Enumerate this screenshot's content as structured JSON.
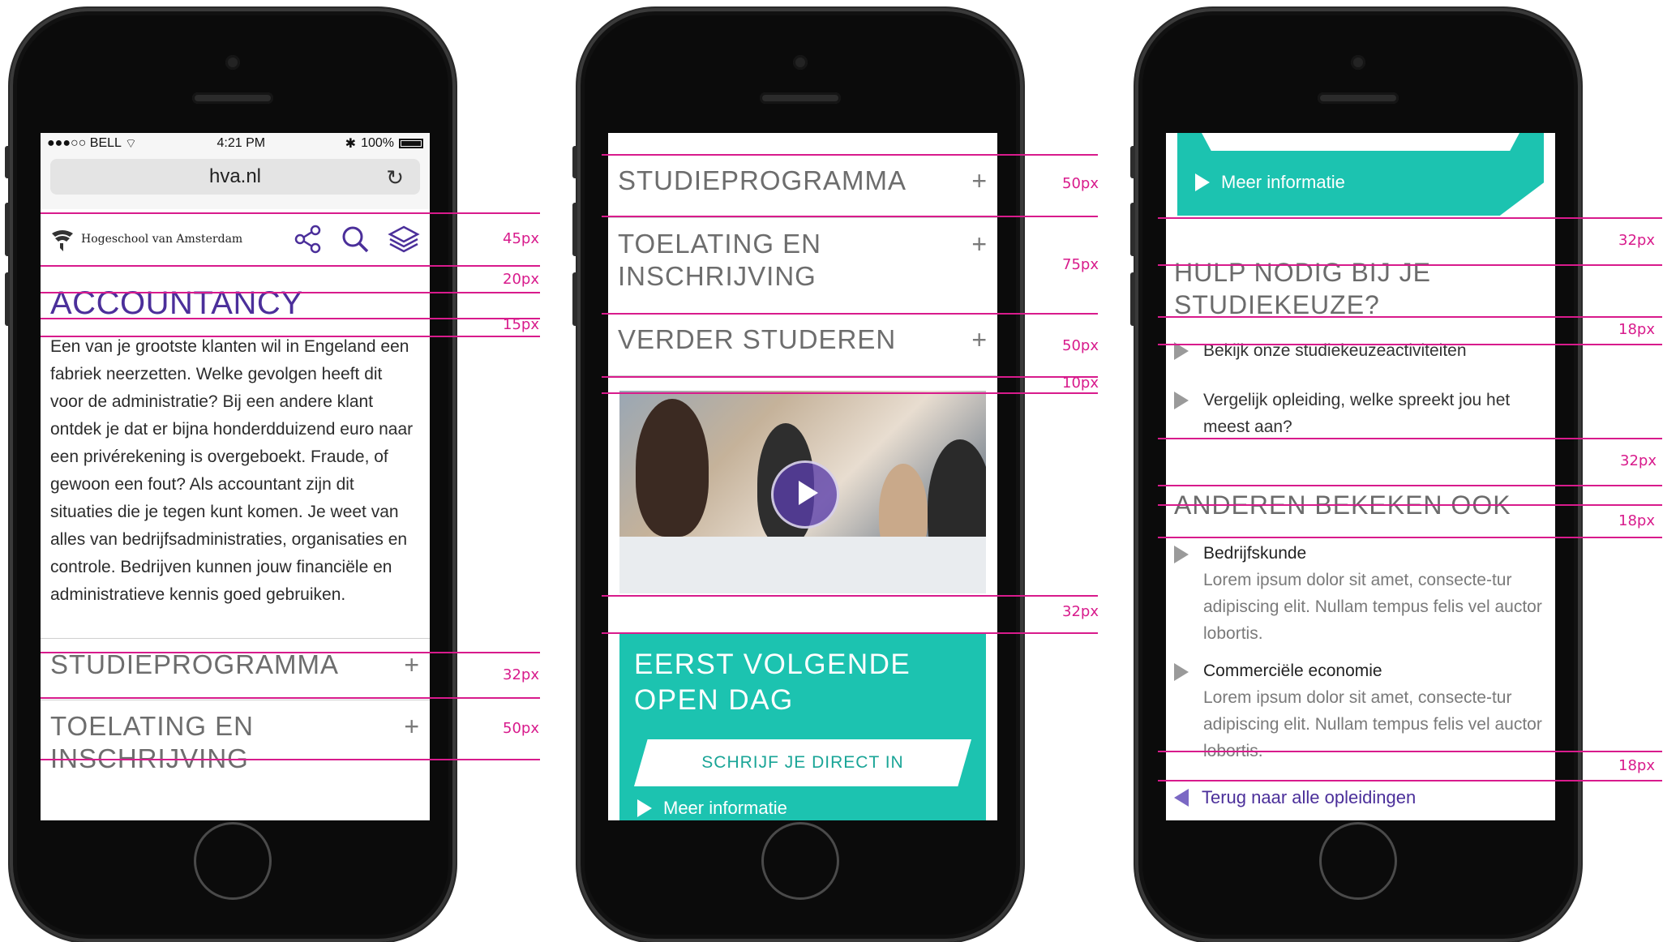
{
  "phone1": {
    "status": {
      "carrier": "●●●○○ BELL",
      "time": "4:21 PM",
      "battery": "100%"
    },
    "url": "hva.nl",
    "logo_text": "Hogeschool van Amsterdam",
    "title": "ACCOUNTANCY",
    "intro": "Een van je grootste klanten wil in Engeland een fabriek neerzetten. Welke gevolgen heeft dit voor de administratie? Bij een andere klant ontdek je dat er bijna honderdduizend euro naar een privérekening is overgeboekt. Fraude, of gewoon een fout? Als accountant zijn dit situaties die je tegen kunt komen. Je weet van alles van bedrijfsadministraties, organisaties en controle. Bedrijven kunnen jouw financiële en administratieve kennis goed gebruiken.",
    "accordion": [
      {
        "label": "STUDIEPROGRAMMA",
        "icon": "+"
      },
      {
        "label": "TOELATING EN INSCHRIJVING",
        "icon": "+"
      }
    ]
  },
  "phone2": {
    "accordion": [
      {
        "label": "STUDIEPROGRAMMA",
        "icon": "+"
      },
      {
        "label": "TOELATING EN INSCHRIJVING",
        "icon": "+"
      },
      {
        "label": "VERDER STUDEREN",
        "icon": "+"
      }
    ],
    "openday": {
      "title": "EERST VOLGENDE OPEN DAG",
      "cta": "SCHRIJF JE DIRECT IN",
      "more": "Meer informatie"
    }
  },
  "phone3": {
    "more": "Meer informatie",
    "help_title": "HULP NODIG BIJ JE STUDIEKEUZE?",
    "help_links": [
      "Bekijk onze studiekeuzeactiviteiten",
      "Vergelijk opleiding, welke spreekt jou het meest aan?"
    ],
    "others_title": "ANDEREN BEKEKEN OOK",
    "related": [
      {
        "title": "Bedrijfskunde",
        "desc": "Lorem ipsum dolor sit amet, consecte-tur adipiscing elit. Nullam tempus felis vel auctor lobortis."
      },
      {
        "title": "Commerciële economie",
        "desc": "Lorem ipsum dolor sit amet, consecte-tur adipiscing elit. Nullam tempus felis vel auctor lobortis."
      }
    ],
    "back": "Terug naar alle opleidingen"
  },
  "annotations": {
    "p1": [
      "45px",
      "20px",
      "15px",
      "32px",
      "50px"
    ],
    "p2": [
      "50px",
      "75px",
      "50px",
      "10px",
      "32px"
    ],
    "p3": [
      "32px",
      "18px",
      "32px",
      "18px",
      "18px"
    ]
  },
  "colors": {
    "accent_purple": "#4b2f9a",
    "teal": "#1cc3b0",
    "guide_magenta": "#d81b8c"
  }
}
